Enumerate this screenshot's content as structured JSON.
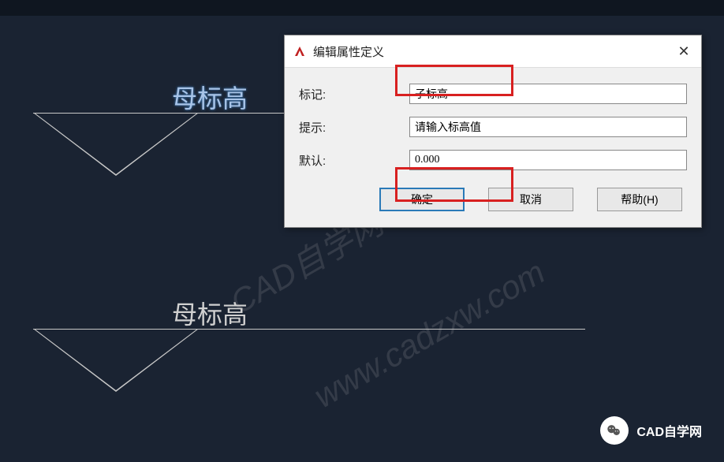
{
  "canvas": {
    "label1": "母标高",
    "label2": "母标高"
  },
  "watermark": {
    "text1": "CAD自学网",
    "text2": "www.cadzxw.com"
  },
  "dialog": {
    "title": "编辑属性定义",
    "fields": {
      "tag_label": "标记:",
      "tag_value": "子标高",
      "prompt_label": "提示:",
      "prompt_value": "请输入标高值",
      "default_label": "默认:",
      "default_value": "0.000"
    },
    "buttons": {
      "ok": "确定",
      "cancel": "取消",
      "help": "帮助(H)"
    }
  },
  "badge": {
    "text": "CAD自学网"
  }
}
